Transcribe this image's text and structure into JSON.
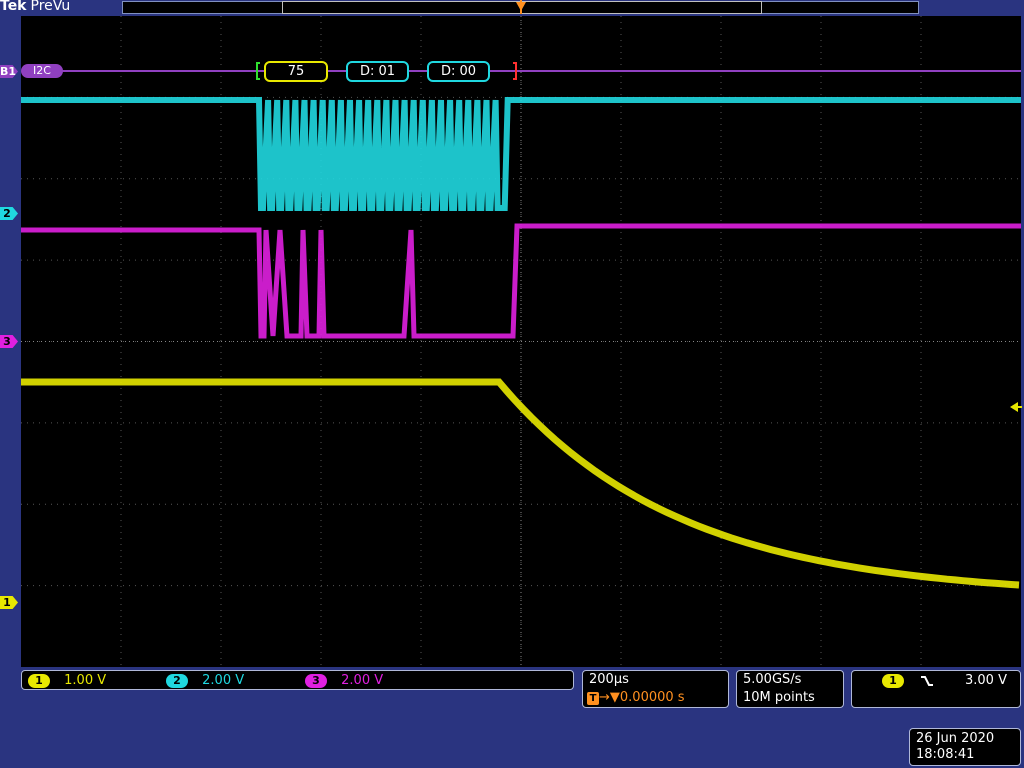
{
  "header": {
    "brand": "Tek",
    "mode": "PreVu"
  },
  "colors": {
    "ch1": "#e8e800",
    "ch2": "#20d8e0",
    "ch3": "#e020e0",
    "bus": "#9040c0",
    "trigger": "#ff9020"
  },
  "markers": {
    "bus": "B1",
    "ch2": "2",
    "ch3": "3",
    "ch1": "1",
    "trigger": "T"
  },
  "bus": {
    "label": "I2C",
    "packets": [
      "75",
      "D: 01",
      "D: 00"
    ]
  },
  "channels": [
    {
      "chip": "1",
      "scale": "1.00 V"
    },
    {
      "chip": "2",
      "scale": "2.00 V"
    },
    {
      "chip": "3",
      "scale": "2.00 V"
    }
  ],
  "timebase": {
    "scale": "200µs",
    "position": "0.00000 s",
    "t_icon": "T"
  },
  "acquisition": {
    "rate": "5.00GS/s",
    "length": "10M points"
  },
  "trigger": {
    "source": "1",
    "slope_icon": "falling-edge-icon",
    "level": "3.00 V"
  },
  "datetime": {
    "date": "26 Jun 2020",
    "time": "18:08:41"
  }
}
